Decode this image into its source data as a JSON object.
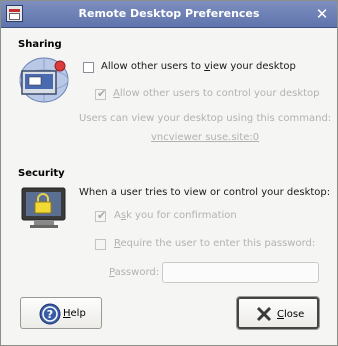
{
  "window": {
    "title": "Remote Desktop Preferences"
  },
  "sharing": {
    "heading": "Sharing",
    "allow_view_pre": "Allow other users to ",
    "allow_view_key": "v",
    "allow_view_post": "iew your desktop",
    "allow_view_checked": false,
    "allow_control_pre": "",
    "allow_control_key": "A",
    "allow_control_post": "llow other users to control your desktop",
    "allow_control_checked": true,
    "command_info": "Users can view your desktop using this command:",
    "command": "vncviewer suse.site:0"
  },
  "security": {
    "heading": "Security",
    "prompt": "When a user tries to view or control your desktop:",
    "ask_pre": "A",
    "ask_key": "s",
    "ask_post": "k you for confirmation",
    "ask_checked": true,
    "require_pw_pre": "",
    "require_pw_key": "R",
    "require_pw_post": "equire the user to enter this password:",
    "require_pw_checked": false,
    "password_pre": "",
    "password_key": "P",
    "password_post": "assword:",
    "password_value": ""
  },
  "buttons": {
    "help_key": "H",
    "help_post": "elp",
    "close_key": "C",
    "close_post": "lose"
  }
}
